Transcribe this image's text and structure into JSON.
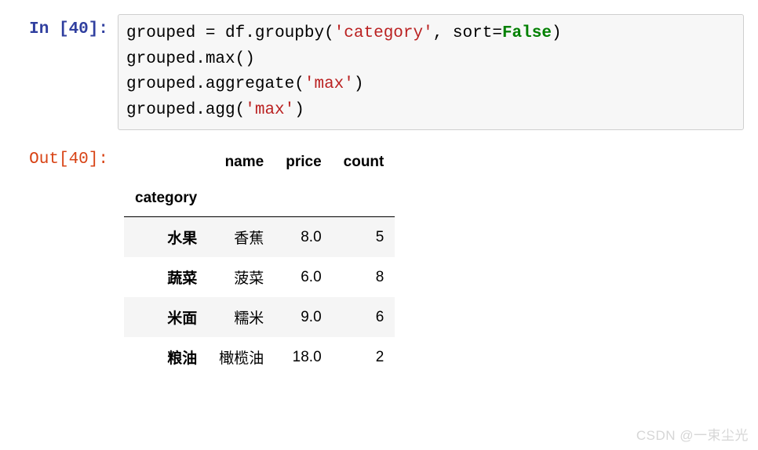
{
  "input": {
    "prompt": "In [40]:",
    "code_tokens": [
      {
        "t": "grouped ",
        "c": "op"
      },
      {
        "t": "=",
        "c": "op"
      },
      {
        "t": " df",
        "c": "op"
      },
      {
        "t": ".",
        "c": "op"
      },
      {
        "t": "groupby(",
        "c": "op"
      },
      {
        "t": "'category'",
        "c": "str"
      },
      {
        "t": ", sort",
        "c": "op"
      },
      {
        "t": "=",
        "c": "op"
      },
      {
        "t": "False",
        "c": "kw"
      },
      {
        "t": ")",
        "c": "op"
      },
      {
        "t": "\n",
        "c": "op"
      },
      {
        "t": "grouped",
        "c": "op"
      },
      {
        "t": ".",
        "c": "op"
      },
      {
        "t": "max()",
        "c": "op"
      },
      {
        "t": "\n",
        "c": "op"
      },
      {
        "t": "grouped",
        "c": "op"
      },
      {
        "t": ".",
        "c": "op"
      },
      {
        "t": "aggregate(",
        "c": "op"
      },
      {
        "t": "'max'",
        "c": "str"
      },
      {
        "t": ")",
        "c": "op"
      },
      {
        "t": "\n",
        "c": "op"
      },
      {
        "t": "grouped",
        "c": "op"
      },
      {
        "t": ".",
        "c": "op"
      },
      {
        "t": "agg(",
        "c": "op"
      },
      {
        "t": "'max'",
        "c": "str"
      },
      {
        "t": ")",
        "c": "op"
      }
    ]
  },
  "output": {
    "prompt": "Out[40]:",
    "chart_data": {
      "type": "table",
      "index_name": "category",
      "columns": [
        "name",
        "price",
        "count"
      ],
      "rows": [
        {
          "index": "水果",
          "name": "香蕉",
          "price": "8.0",
          "count": "5"
        },
        {
          "index": "蔬菜",
          "name": "菠菜",
          "price": "6.0",
          "count": "8"
        },
        {
          "index": "米面",
          "name": "糯米",
          "price": "9.0",
          "count": "6"
        },
        {
          "index": "粮油",
          "name": "橄榄油",
          "price": "18.0",
          "count": "2"
        }
      ]
    }
  },
  "watermark": "CSDN @一束尘光"
}
